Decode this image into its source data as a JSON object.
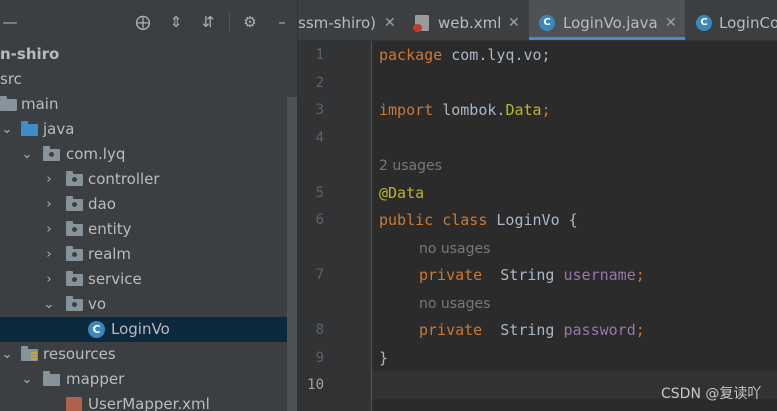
{
  "toolbar": {
    "buttons": [
      "locate-icon",
      "expand-all-icon",
      "collapse-all-icon",
      "gear-icon",
      "minimize-icon"
    ]
  },
  "project_tree": [
    {
      "label": "n-shiro",
      "bold": true
    },
    {
      "label": "src"
    },
    {
      "label": "main"
    },
    {
      "label": "java"
    },
    {
      "label": "com.lyq"
    },
    {
      "label": "controller"
    },
    {
      "label": "dao"
    },
    {
      "label": "entity"
    },
    {
      "label": "realm"
    },
    {
      "label": "service"
    },
    {
      "label": "vo"
    },
    {
      "label": "LoginVo",
      "selected": true
    },
    {
      "label": "resources"
    },
    {
      "label": "mapper"
    },
    {
      "label": "UserMapper.xml"
    }
  ],
  "tabs": [
    {
      "label": "ssm-shiro)"
    },
    {
      "label": "web.xml"
    },
    {
      "label": "LoginVo.java",
      "active": true
    },
    {
      "label": "LoginCo"
    }
  ],
  "line_numbers": [
    "1",
    "2",
    "3",
    "4",
    "5",
    "6",
    "7",
    "8",
    "9",
    "10"
  ],
  "code": {
    "line1_kw": "package",
    "line1_rest": " com.lyq.vo;",
    "line3_kw": "import",
    "line3_rest": " lombok.",
    "line3_ann": "Data",
    "line3_end": ";",
    "inlay_usages_5": "2 usages",
    "line5_ann": "@Data",
    "line6_kw": "public class",
    "line6_rest": " LoginVo {",
    "inlay_usages_7": "no usages",
    "line7_kw": "private",
    "line7_type": "  String ",
    "line7_field": "username",
    "line7_end": ";",
    "inlay_usages_8": "no usages",
    "line8_kw": "private",
    "line8_type": "  String ",
    "line8_field": "password",
    "line8_end": ";",
    "line9": "}"
  },
  "watermark": "CSDN @复读吖",
  "colors": {
    "keyword": "#cc7832",
    "annotation": "#bbb529",
    "field": "#9876aa",
    "accent": "#4a88c7"
  }
}
